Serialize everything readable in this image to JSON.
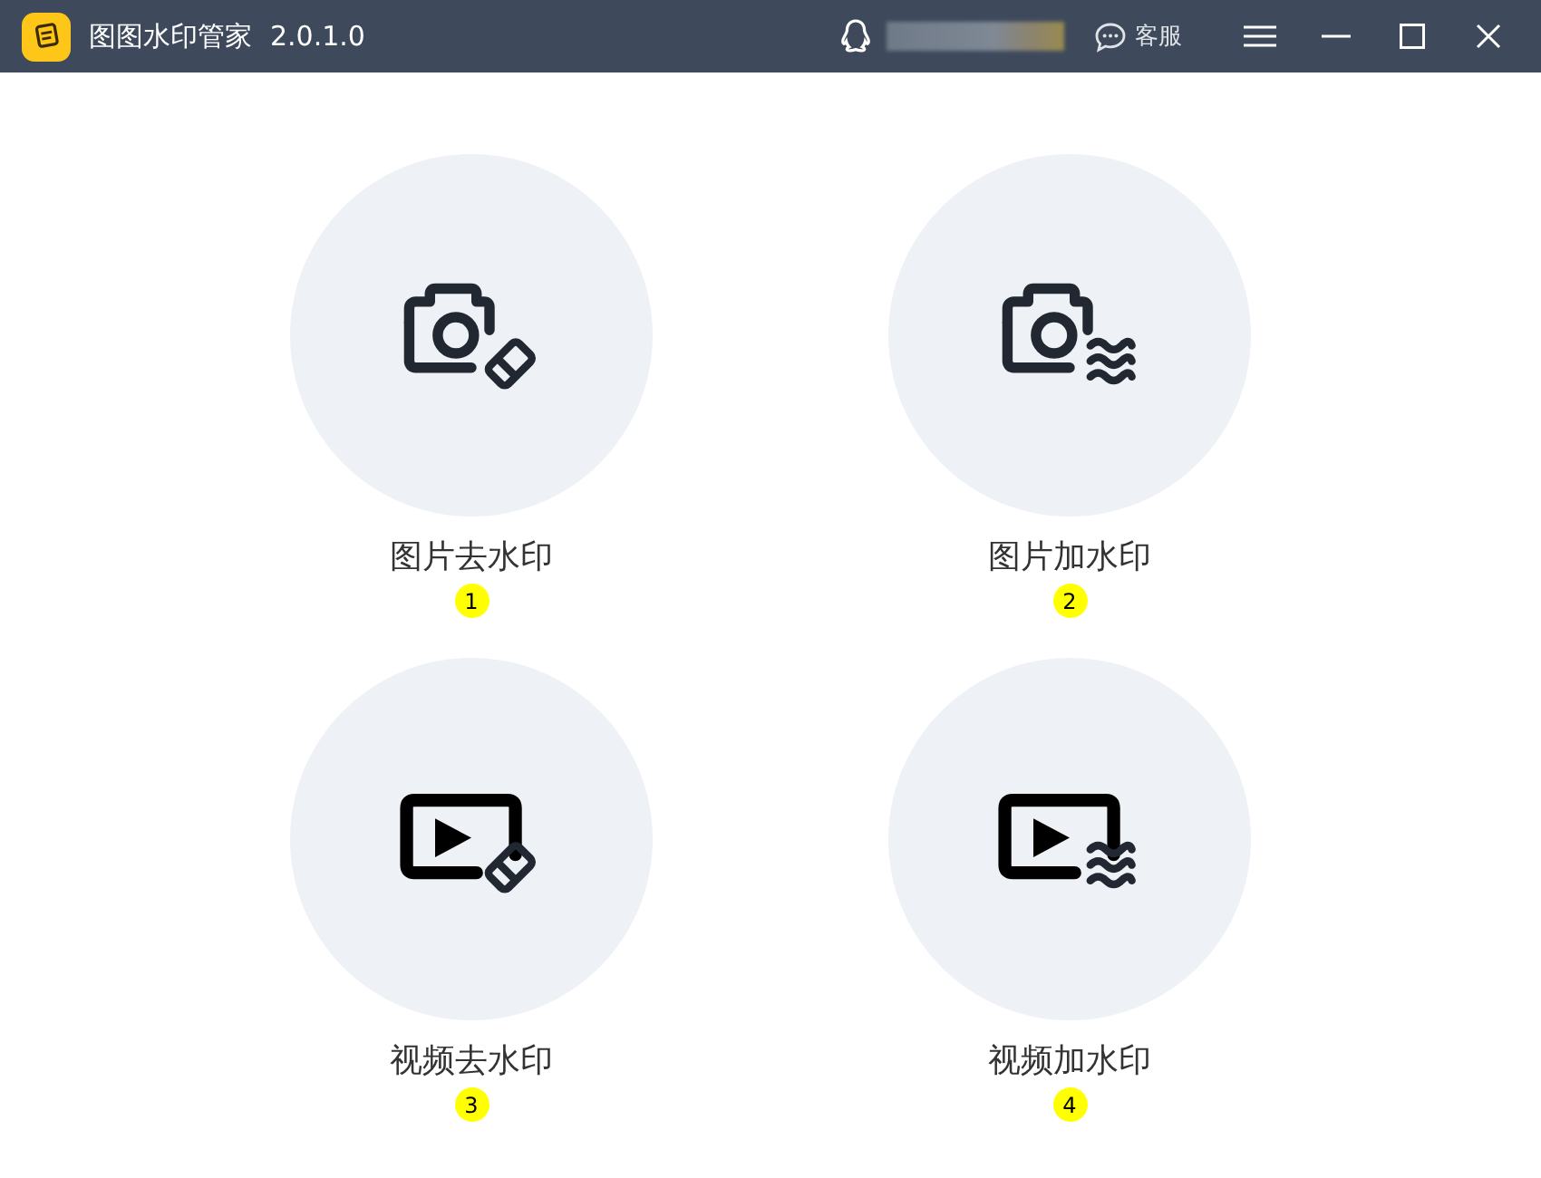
{
  "window": {
    "title": "图图水印管家",
    "version": "2.0.1.0"
  },
  "header": {
    "support": "客服"
  },
  "tools": [
    {
      "label": "图片去水印",
      "badge": "1",
      "kind": "photo-eraser"
    },
    {
      "label": "图片加水印",
      "badge": "2",
      "kind": "photo-waves"
    },
    {
      "label": "视频去水印",
      "badge": "3",
      "kind": "video-eraser"
    },
    {
      "label": "视频加水印",
      "badge": "4",
      "kind": "video-waves"
    }
  ]
}
